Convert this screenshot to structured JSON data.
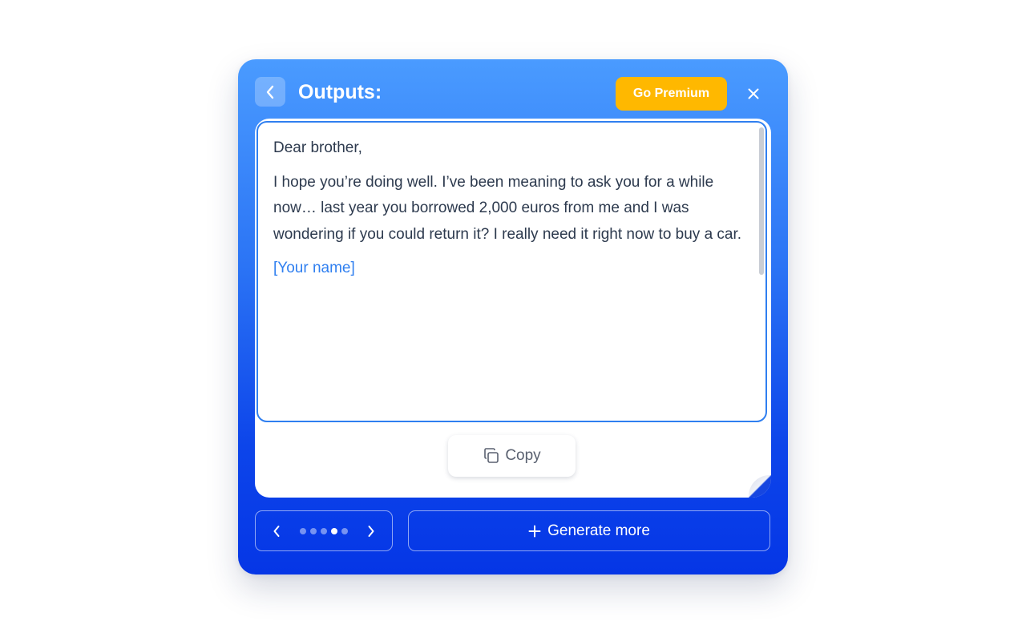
{
  "header": {
    "title": "Outputs:",
    "premium_label": "Go Premium"
  },
  "output": {
    "greeting": "Dear brother,",
    "body": "I hope you’re doing well. I’ve been meaning to ask you for a while now… last year you borrowed 2,000 euros from me and I was wondering if you could return it? I really need it right now to buy a car.",
    "signature": "[Your name]"
  },
  "actions": {
    "copy_label": "Copy",
    "generate_label": "Generate more"
  },
  "pager": {
    "total_pages": 5,
    "current_page": 4
  },
  "colors": {
    "accent": "#2f7ff0",
    "premium": "#ffb800",
    "panel_top": "#4a9bff",
    "panel_bottom": "#0536e6"
  },
  "icons": {
    "back": "chevron-left-icon",
    "close": "close-icon",
    "copy": "copy-icon",
    "prev": "chevron-left-icon",
    "next": "chevron-right-icon",
    "generate": "plus-icon"
  }
}
